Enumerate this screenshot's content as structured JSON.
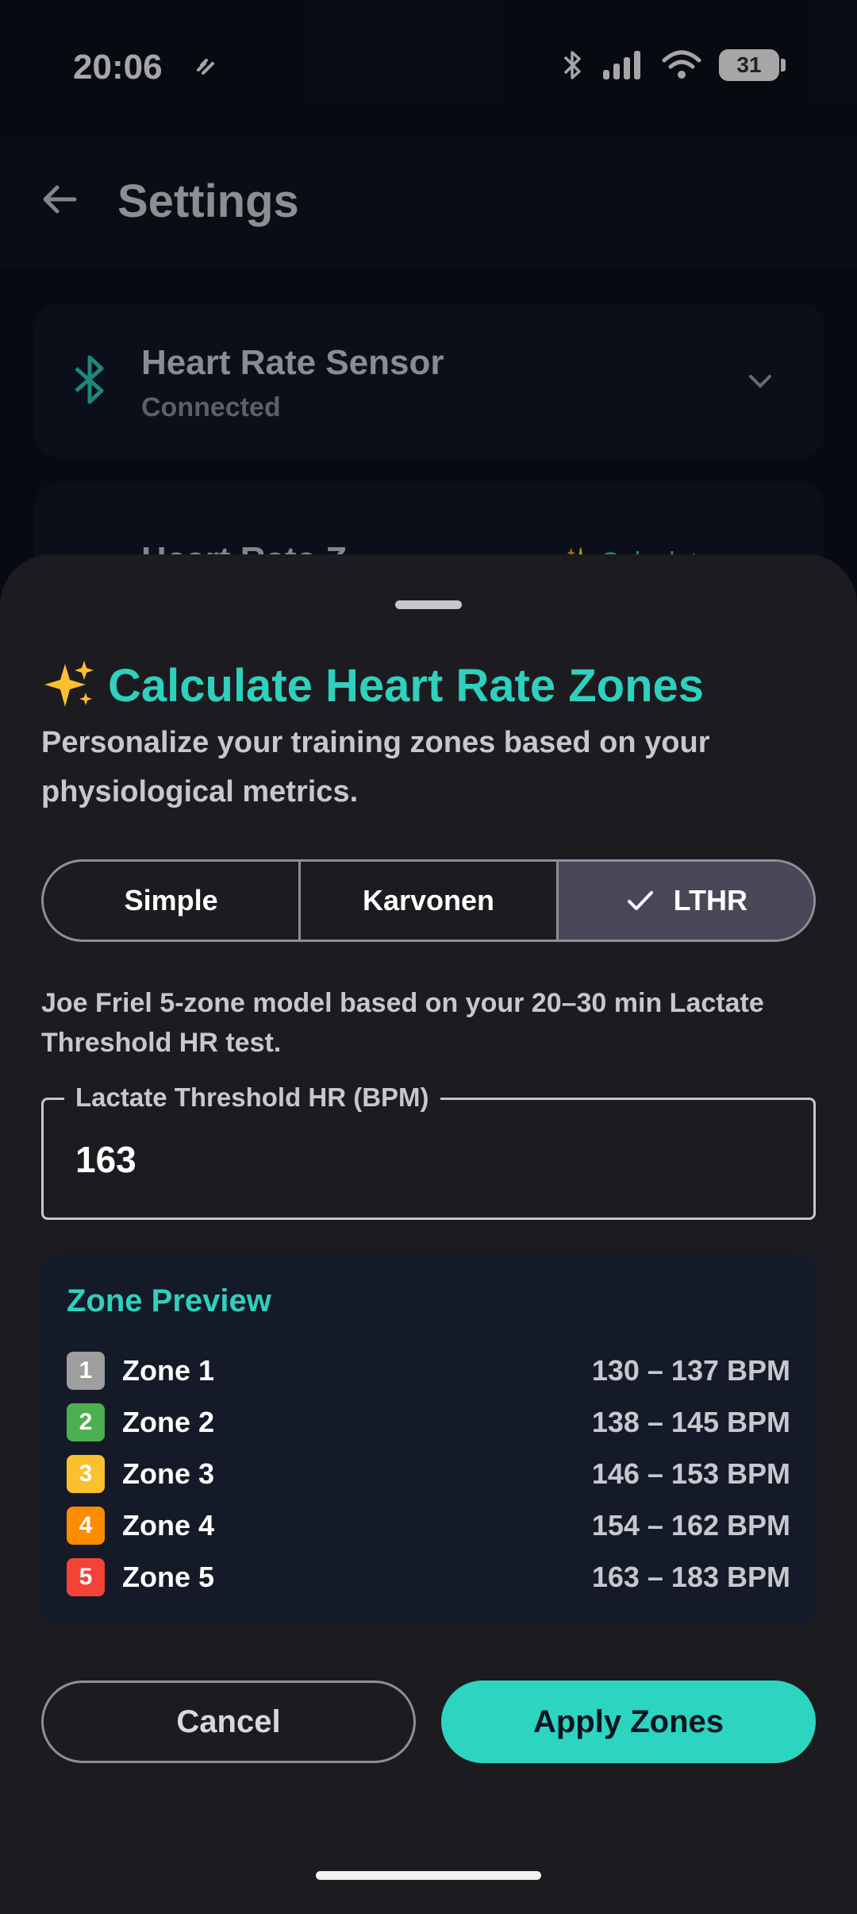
{
  "status_bar": {
    "time": "20:06",
    "battery": "31",
    "battery_level": 0.31
  },
  "app_bar": {
    "title": "Settings"
  },
  "cards": [
    {
      "title": "Heart Rate Sensor",
      "subtitle": "Connected"
    },
    {
      "title": "Heart Rate Z",
      "action": "✨ Calculate"
    }
  ],
  "sheet": {
    "title": "Calculate Heart Rate Zones",
    "description": "Personalize your training zones based on your physiological metrics.",
    "methods": [
      {
        "label": "Simple"
      },
      {
        "label": "Karvonen"
      },
      {
        "label": "LTHR"
      }
    ],
    "selected_method": "LTHR",
    "method_description": "Joe Friel 5-zone model based on your 20–30 min Lactate Threshold HR test.",
    "field": {
      "label": "Lactate Threshold HR (BPM)",
      "value": "163"
    },
    "preview": {
      "title": "Zone Preview",
      "zones": [
        {
          "num": "1",
          "name": "Zone 1",
          "range": "130 – 137 BPM",
          "color": "#9e9e9e"
        },
        {
          "num": "2",
          "name": "Zone 2",
          "range": "138 – 145 BPM",
          "color": "#4caf50"
        },
        {
          "num": "3",
          "name": "Zone 3",
          "range": "146 – 153 BPM",
          "color": "#fbc02d"
        },
        {
          "num": "4",
          "name": "Zone 4",
          "range": "154 – 162 BPM",
          "color": "#fb8c00"
        },
        {
          "num": "5",
          "name": "Zone 5",
          "range": "163 – 183 BPM",
          "color": "#f44336"
        }
      ]
    },
    "cancel_label": "Cancel",
    "apply_label": "Apply Zones"
  },
  "colors": {
    "accent": "#2dd4bf",
    "sheet_bg": "#1c1b20",
    "preview_bg": "#141a28",
    "selected_segment": "#4a4758"
  }
}
